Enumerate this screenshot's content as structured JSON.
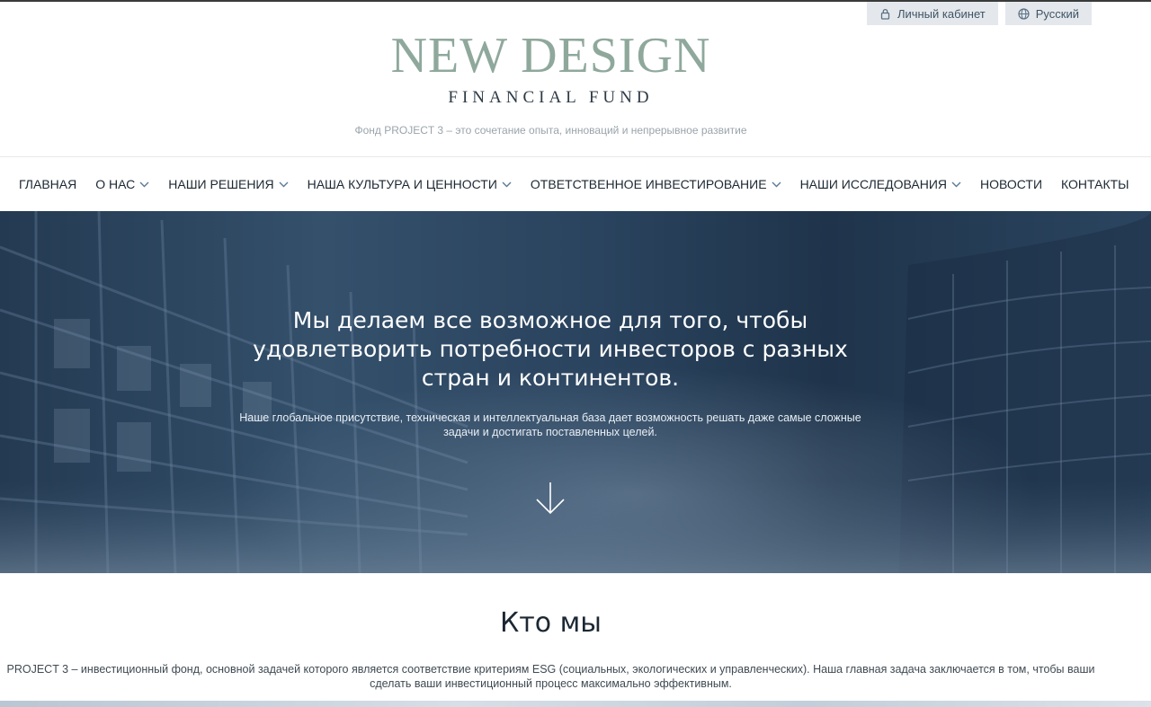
{
  "header": {
    "account_label": "Личный кабинет",
    "account_icon": "lock-icon",
    "language_label": "Русский",
    "language_icon": "globe-icon",
    "logo_main": "NEW DESIGN",
    "logo_sub": "FINANCIAL FUND",
    "tagline": "Фонд PROJECT 3 – это сочетание опыта, инноваций и непрерывное развитие"
  },
  "nav": {
    "items": [
      {
        "label": "ГЛАВНАЯ",
        "dropdown": false
      },
      {
        "label": "О НАС",
        "dropdown": true
      },
      {
        "label": "НАШИ РЕШЕНИЯ",
        "dropdown": true
      },
      {
        "label": "НАША КУЛЬТУРА И ЦЕННОСТИ",
        "dropdown": true
      },
      {
        "label": "ОТВЕТСТВЕННОЕ ИНВЕСТИРОВАНИЕ",
        "dropdown": true
      },
      {
        "label": "НАШИ ИССЛЕДОВАНИЯ",
        "dropdown": true
      },
      {
        "label": "НОВОСТИ",
        "dropdown": false
      },
      {
        "label": "КОНТАКТЫ",
        "dropdown": false
      }
    ]
  },
  "hero": {
    "title": "Мы делаем все возможное для того, чтобы удовлетворить потребности инвесторов с разных стран и континентов.",
    "text": "Наше глобальное присутствие, техническая и интеллектуальная база дает возможность решать даже самые сложные задачи и достигать поставленных целей.",
    "arrow_icon": "arrow-down-icon"
  },
  "about": {
    "title": "Кто мы",
    "text": "PROJECT 3 – инвестиционный фонд, основной задачей которого является соответствие критериям ESG (социальных, экологических и управленческих). Наша главная задача заключается в том, чтобы ваши сделать ваши инвестиционный процесс максимально эффективным."
  },
  "colors": {
    "logo_green": "#8fa89c",
    "hero_blue": "#2a435e",
    "util_bg": "#e4e8ec"
  }
}
